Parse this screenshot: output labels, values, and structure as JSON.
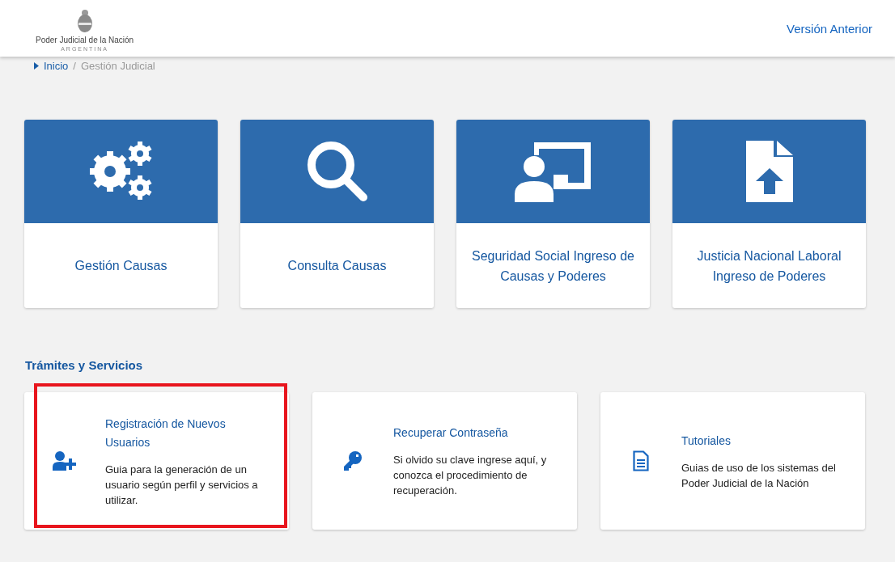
{
  "header": {
    "logo_title": "Poder Judicial de la Nación",
    "logo_subtitle": "ARGENTINA",
    "link": "Versión Anterior"
  },
  "breadcrumb": [
    {
      "label": "Inicio"
    },
    {
      "label": "Gestión Judicial"
    }
  ],
  "breadcrumb_separator": "/",
  "apps": [
    {
      "kind": "gears",
      "label": "Gestión Causas"
    },
    {
      "kind": "search",
      "label": "Consulta Causas"
    },
    {
      "kind": "teacher",
      "label": "Seguridad Social Ingreso de Causas y Poderes"
    },
    {
      "kind": "upload",
      "label": "Justicia Nacional Laboral Ingreso de Poderes"
    }
  ],
  "services_title": "Trámites y Servicios",
  "services": [
    {
      "kind": "user-add",
      "title": "Registración de Nuevos Usuarios",
      "description": "Guia para la generación de un usuario según perfil y servicios a utilizar.",
      "highlighted": true
    },
    {
      "kind": "key",
      "title": "Recuperar Contraseña",
      "description": "Si olvido su clave ingrese aquí, y conozca el procedimiento de recuperación.",
      "highlighted": false
    },
    {
      "kind": "document",
      "title": "Tutoriales",
      "description": "Guias de uso de los sistemas del Poder Judicial de la Nación",
      "highlighted": false
    }
  ]
}
